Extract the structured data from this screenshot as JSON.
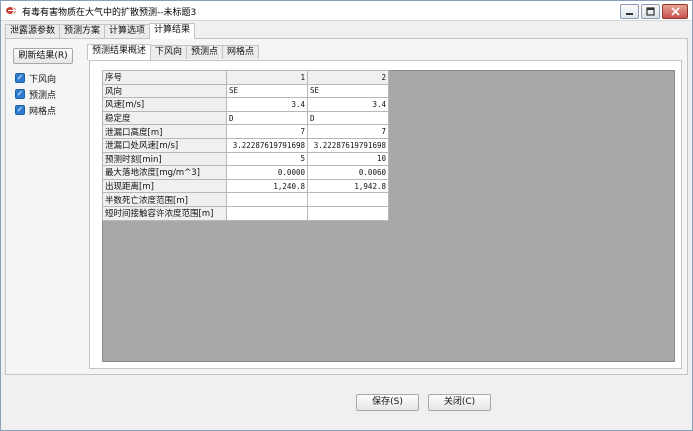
{
  "window": {
    "title": "有毒有害物质在大气中的扩散预测--未标题3"
  },
  "outer_tabs": [
    "泄露源参数",
    "预测方案",
    "计算选项",
    "计算结果"
  ],
  "outer_active": 3,
  "left_panel": {
    "refresh_label": "刷新结果(R)",
    "checks": [
      {
        "label": "下风向",
        "checked": true
      },
      {
        "label": "预测点",
        "checked": true
      },
      {
        "label": "网格点",
        "checked": true
      }
    ]
  },
  "inner_tabs": [
    "预测结果概述",
    "下风向",
    "预测点",
    "网格点"
  ],
  "inner_active": 0,
  "table": {
    "header": {
      "label": "序号",
      "cols": [
        "1",
        "2"
      ]
    },
    "rows": [
      {
        "label": "风向",
        "values": [
          "SE",
          "SE"
        ],
        "align": "txt"
      },
      {
        "label": "风速[m/s]",
        "values": [
          "3.4",
          "3.4"
        ],
        "align": "num"
      },
      {
        "label": "稳定度",
        "values": [
          "D",
          "D"
        ],
        "align": "txt"
      },
      {
        "label": "泄漏口高度[m]",
        "values": [
          "7",
          "7"
        ],
        "align": "num"
      },
      {
        "label": "泄漏口处风速[m/s]",
        "values": [
          "3.22287619791698",
          "3.22287619791698"
        ],
        "align": "num"
      },
      {
        "label": "预测时刻[min]",
        "values": [
          "5",
          "10"
        ],
        "align": "num"
      },
      {
        "label": "最大落地浓度[mg/m^3]",
        "values": [
          "0.0000",
          "0.0060"
        ],
        "align": "num"
      },
      {
        "label": "出现距离[m]",
        "values": [
          "1,240.8",
          "1,942.8"
        ],
        "align": "num"
      },
      {
        "label": "半数死亡浓度范围[m]",
        "values": [
          "",
          ""
        ],
        "align": "num"
      },
      {
        "label": "短时间接触容许浓度范围[m]",
        "values": [
          "",
          ""
        ],
        "align": "num"
      }
    ]
  },
  "buttons": {
    "save": "保存(S)",
    "close": "关闭(C)"
  }
}
